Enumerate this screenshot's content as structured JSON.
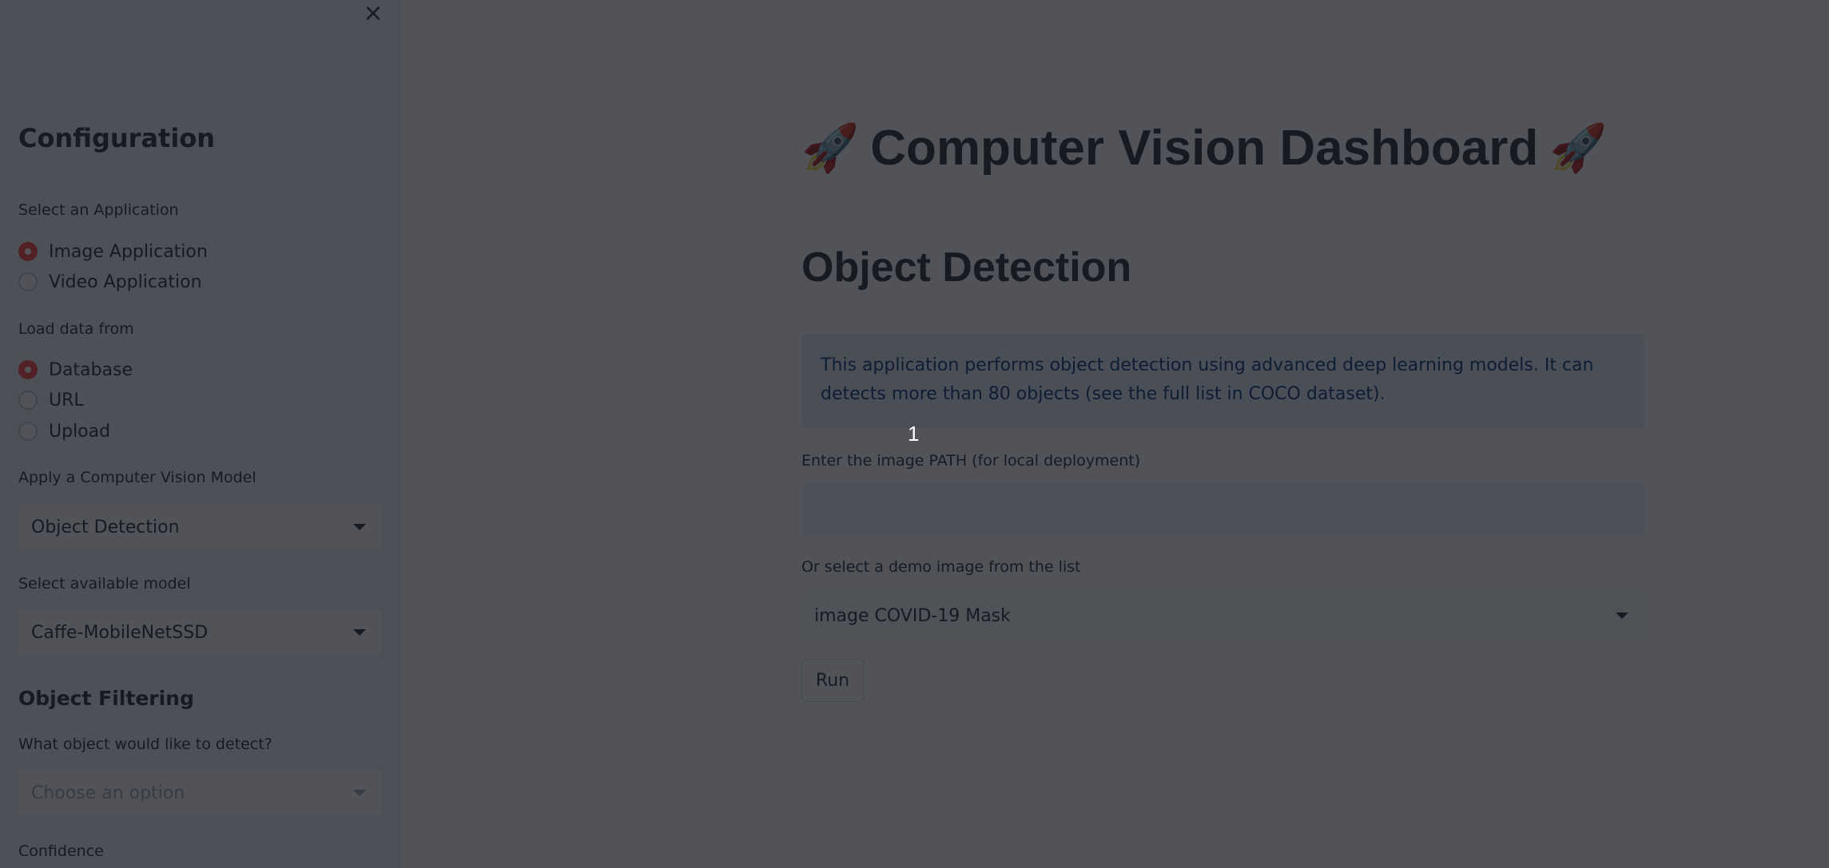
{
  "sidebar": {
    "close_icon": "×",
    "title": "Configuration",
    "app_label": "Select an Application",
    "app_options": [
      "Image Application",
      "Video Application"
    ],
    "app_selected": 0,
    "load_label": "Load data from",
    "load_options": [
      "Database",
      "URL",
      "Upload"
    ],
    "load_selected": 0,
    "model_label": "Apply a Computer Vision Model",
    "model_value": "Object Detection",
    "available_label": "Select available model",
    "available_value": "Caffe-MobileNetSSD",
    "filter_title": "Object Filtering",
    "filter_label": "What object would like to detect?",
    "filter_placeholder": "Choose an option",
    "confidence_label": "Confidence"
  },
  "main": {
    "title": "Computer Vision Dashboard",
    "rocket": "🚀",
    "section_title": "Object Detection",
    "info_text": "This application performs object detection using advanced deep learning models. It can detects more than 80 objects (see the full list in COCO dataset).",
    "path_label": "Enter the image PATH (for local deployment)",
    "demo_label": "Or select a demo image from the list",
    "demo_value": "image COVID-19 Mask",
    "run_label": "Run"
  },
  "overlay": {
    "marker": "1"
  },
  "colors": {
    "accent": "#ff4b4b",
    "text": "#31333f",
    "info_bg": "#e6f0fb"
  }
}
